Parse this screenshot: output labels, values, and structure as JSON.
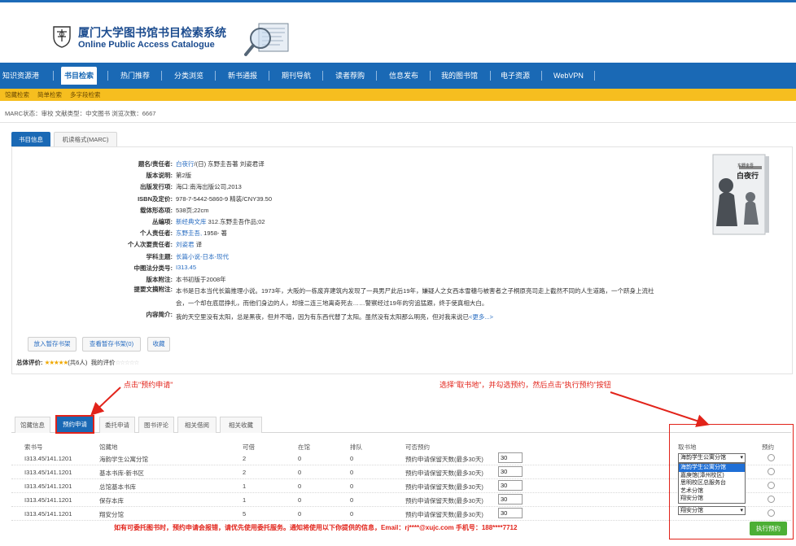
{
  "header": {
    "title_cn": "厦门大学图书馆书目检索系统",
    "title_en": "Online Public Access Catalogue"
  },
  "nav": {
    "items": [
      "知识资源港",
      "书目检索",
      "热门推荐",
      "分类浏览",
      "新书通报",
      "期刊导航",
      "读者荐购",
      "信息发布",
      "我的图书馆",
      "电子资源",
      "WebVPN"
    ],
    "active": "书目检索"
  },
  "subnav": {
    "items": [
      "馆藏检索",
      "简单检索",
      "多字段检索"
    ]
  },
  "marc_status": "MARC状态：审校  文献类型：中文图书 浏览次数：6667",
  "info_tabs": [
    "书目信息",
    "机读格式(MARC)"
  ],
  "book": {
    "fields": [
      {
        "label": "题名/责任者:",
        "value_link": "白夜行",
        "value": "/(日) 东野圭吾著 刘姿君译"
      },
      {
        "label": "版本说明:",
        "value_link": "",
        "value": "第2版"
      },
      {
        "label": "出版发行项:",
        "value_link": "",
        "value": "海口:南海出版公司,2013"
      },
      {
        "label": "ISBN及定价:",
        "value_link": "",
        "value": "978-7-5442-5860-9 精装/CNY39.50"
      },
      {
        "label": "载体形态项:",
        "value_link": "",
        "value": "538页;22cm"
      },
      {
        "label": "丛编项:",
        "value_link": "新经典文库",
        "value": " 312.东野圭吾作品;02"
      },
      {
        "label": "个人责任者:",
        "value_link": "东野圭吾,",
        "value": " 1958- 著"
      },
      {
        "label": "个人次要责任者:",
        "value_link": "刘姿君",
        "value": " 译"
      },
      {
        "label": "学科主题:",
        "value_link": "长篇小说-日本-现代",
        "value": ""
      },
      {
        "label": "中图法分类号:",
        "value_link": "I313.45",
        "value": ""
      },
      {
        "label": "版本附注:",
        "value_link": "",
        "value": "本书初版于2008年"
      }
    ],
    "summary_label": "提要文摘附注:",
    "summary": "本书是日本当代长篇推理小说。1973年，大阪的一栋废弃建筑内发现了一具男尸此后19年，嫌疑人之女西本雪穗与被害者之子桐原亮司走上截然不同的人生道路，一个跻身上流社会，一个却在底层挣扎，而他们身边的人，却接二连三地离奇死去……警察经过19年的穷追猛跟，终于使真相大白。",
    "content_label": "内容简介:",
    "content": "我的天空里没有太阳，总是黑夜，但并不暗，因为有东西代替了太阳。虽然没有太阳那么明亮，但对我来说已",
    "content_more": "<更多...>",
    "cover_title": "白夜行",
    "cover_author": "东野圭吾"
  },
  "buttons": {
    "add_shelf": "放入暂存书架",
    "view_shelf": "查看暂存书架(0)",
    "favorite": "收藏"
  },
  "rating": {
    "label": "总体评价:",
    "stars": "★★★★★",
    "count": "(共6人)",
    "my_label": "我的评价",
    "my_stars": "☆☆☆☆☆"
  },
  "annotations": {
    "click_reserve": "点击\"预约申请\"",
    "select_pickup": "选择\"取书地\"，并勾选预约，然后点击\"执行预约\"按钮"
  },
  "lower_tabs": [
    "馆藏信息",
    "预约申请",
    "委托申请",
    "图书评论",
    "相关借阅",
    "相关收藏"
  ],
  "lower_active": "预约申请",
  "table": {
    "headers": [
      "索书号",
      "馆藏地",
      "可借",
      "在馆",
      "排队",
      "可否预约",
      "取书地",
      "预约"
    ],
    "rows": [
      {
        "call": "I313.45/141.1201",
        "loc": "海韵学生公寓分馆",
        "avail": "2",
        "inlib": "0",
        "queue": "0",
        "reserve": "预约申请保留天数(最多30天)",
        "days": "30"
      },
      {
        "call": "I313.45/141.1201",
        "loc": "基本书库-新书区",
        "avail": "2",
        "inlib": "0",
        "queue": "0",
        "reserve": "预约申请保留天数(最多30天)",
        "days": "30"
      },
      {
        "call": "I313.45/141.1201",
        "loc": "总馆基本书库",
        "avail": "1",
        "inlib": "0",
        "queue": "0",
        "reserve": "预约申请保留天数(最多30天)",
        "days": "30"
      },
      {
        "call": "I313.45/141.1201",
        "loc": "保存本库",
        "avail": "1",
        "inlib": "0",
        "queue": "0",
        "reserve": "预约申请保留天数(最多30天)",
        "days": "30"
      },
      {
        "call": "I313.45/141.1201",
        "loc": "翔安分馆",
        "avail": "5",
        "inlib": "0",
        "queue": "0",
        "reserve": "预约申请保留天数(最多30天)",
        "days": "30"
      }
    ]
  },
  "pickup": {
    "selected": "海韵学生公寓分馆",
    "options": [
      "海韵学生公寓分馆",
      "嘉庚馆(漳州校区)",
      "思明校区总服务台",
      "艺术分馆",
      "翔安分馆"
    ],
    "bottom_selected": "翔安分馆"
  },
  "exec_button": "执行预约",
  "bottom_note": "如有可委托图书时，预约申请会报错，请优先使用委托服务。通知将使用以下你提供的信息，Email：rj****@xujc.com 手机号：188****7712"
}
